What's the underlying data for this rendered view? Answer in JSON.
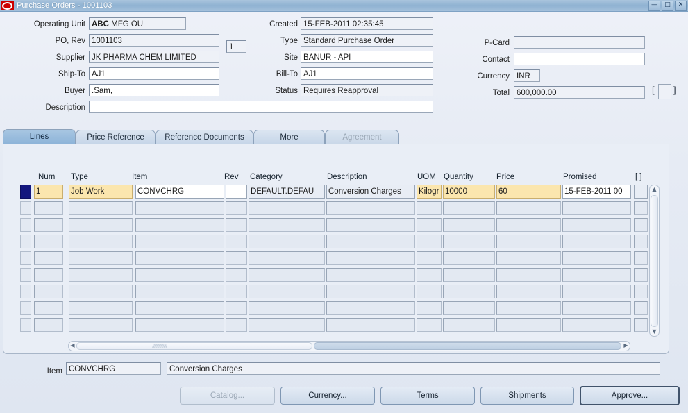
{
  "window": {
    "title": "Purchase Orders - 1001103",
    "logo_icon": "oracle-logo-icon",
    "minimize": "—",
    "maximize": "□",
    "close": "✕"
  },
  "header": {
    "operating_unit": {
      "label": "Operating Unit",
      "value_bold": "ABC",
      "value_rest": " MFG OU"
    },
    "po": {
      "label": "PO, Rev",
      "value": "1001103"
    },
    "rev": {
      "value": "1"
    },
    "supplier": {
      "label": "Supplier",
      "value": "JK PHARMA CHEM LIMITED"
    },
    "ship_to": {
      "label": "Ship-To",
      "value": "AJ1"
    },
    "buyer": {
      "label": "Buyer",
      "value": ".Sam,"
    },
    "description": {
      "label": "Description",
      "value": ""
    },
    "created": {
      "label": "Created",
      "value": "15-FEB-2011 02:35:45"
    },
    "type": {
      "label": "Type",
      "value": "Standard Purchase Order"
    },
    "site": {
      "label": "Site",
      "value": "BANUR - API"
    },
    "bill_to": {
      "label": "Bill-To",
      "value": "AJ1"
    },
    "status": {
      "label": "Status",
      "value": "Requires Reapproval"
    },
    "pcard": {
      "label": "P-Card",
      "value": ""
    },
    "contact": {
      "label": "Contact",
      "value": ""
    },
    "currency": {
      "label": "Currency",
      "value": "INR"
    },
    "total": {
      "label": "Total",
      "value": "600,000.00"
    },
    "dff_open": "[",
    "dff_close": "]"
  },
  "tabs": [
    {
      "label": "Lines",
      "state": "active"
    },
    {
      "label": "Price Reference",
      "state": "inactive"
    },
    {
      "label": "Reference Documents",
      "state": "inactive"
    },
    {
      "label": "More",
      "state": "inactive"
    },
    {
      "label": "Agreement",
      "state": "disabled"
    }
  ],
  "lines_grid": {
    "columns": [
      "Num",
      "Type",
      "Item",
      "Rev",
      "Category",
      "Description",
      "UOM",
      "Quantity",
      "Price",
      "Promised"
    ],
    "dff_header": "[  ]",
    "rows": [
      {
        "num": "1",
        "type": "Job Work",
        "item": "CONVCHRG",
        "rev": "",
        "category": "DEFAULT.DEFAU",
        "description": "Conversion Charges",
        "uom": "Kilogr",
        "quantity": "10000",
        "price": "60",
        "promised": "15-FEB-2011 00"
      },
      {
        "num": "",
        "type": "",
        "item": "",
        "rev": "",
        "category": "",
        "description": "",
        "uom": "",
        "quantity": "",
        "price": "",
        "promised": ""
      },
      {
        "num": "",
        "type": "",
        "item": "",
        "rev": "",
        "category": "",
        "description": "",
        "uom": "",
        "quantity": "",
        "price": "",
        "promised": ""
      },
      {
        "num": "",
        "type": "",
        "item": "",
        "rev": "",
        "category": "",
        "description": "",
        "uom": "",
        "quantity": "",
        "price": "",
        "promised": ""
      },
      {
        "num": "",
        "type": "",
        "item": "",
        "rev": "",
        "category": "",
        "description": "",
        "uom": "",
        "quantity": "",
        "price": "",
        "promised": ""
      },
      {
        "num": "",
        "type": "",
        "item": "",
        "rev": "",
        "category": "",
        "description": "",
        "uom": "",
        "quantity": "",
        "price": "",
        "promised": ""
      },
      {
        "num": "",
        "type": "",
        "item": "",
        "rev": "",
        "category": "",
        "description": "",
        "uom": "",
        "quantity": "",
        "price": "",
        "promised": ""
      },
      {
        "num": "",
        "type": "",
        "item": "",
        "rev": "",
        "category": "",
        "description": "",
        "uom": "",
        "quantity": "",
        "price": "",
        "promised": ""
      },
      {
        "num": "",
        "type": "",
        "item": "",
        "rev": "",
        "category": "",
        "description": "",
        "uom": "",
        "quantity": "",
        "price": "",
        "promised": ""
      }
    ]
  },
  "scroll": {
    "up_arrow": "▲",
    "down_arrow": "▼",
    "left_arrow": "◀",
    "right_arrow": "▶",
    "grip": "//////////////"
  },
  "footer": {
    "item_label": "Item",
    "item_code": "CONVCHRG",
    "item_desc": "Conversion Charges",
    "buttons": [
      {
        "label": "Catalog...",
        "state": "disabled",
        "mnemonic": "C"
      },
      {
        "label": "Currency...",
        "state": "normal",
        "mnemonic": "y"
      },
      {
        "label": "Terms",
        "state": "normal",
        "mnemonic": "m"
      },
      {
        "label": "Shipments",
        "state": "normal",
        "mnemonic": ""
      },
      {
        "label": "Approve...",
        "state": "default",
        "mnemonic": "A"
      }
    ]
  },
  "colors": {
    "titlebar": "#8fb2d2",
    "accent": "#13177e",
    "required_field": "#fbe6ae",
    "canvas": "#e9eef6",
    "logo_red": "#cc0000"
  }
}
